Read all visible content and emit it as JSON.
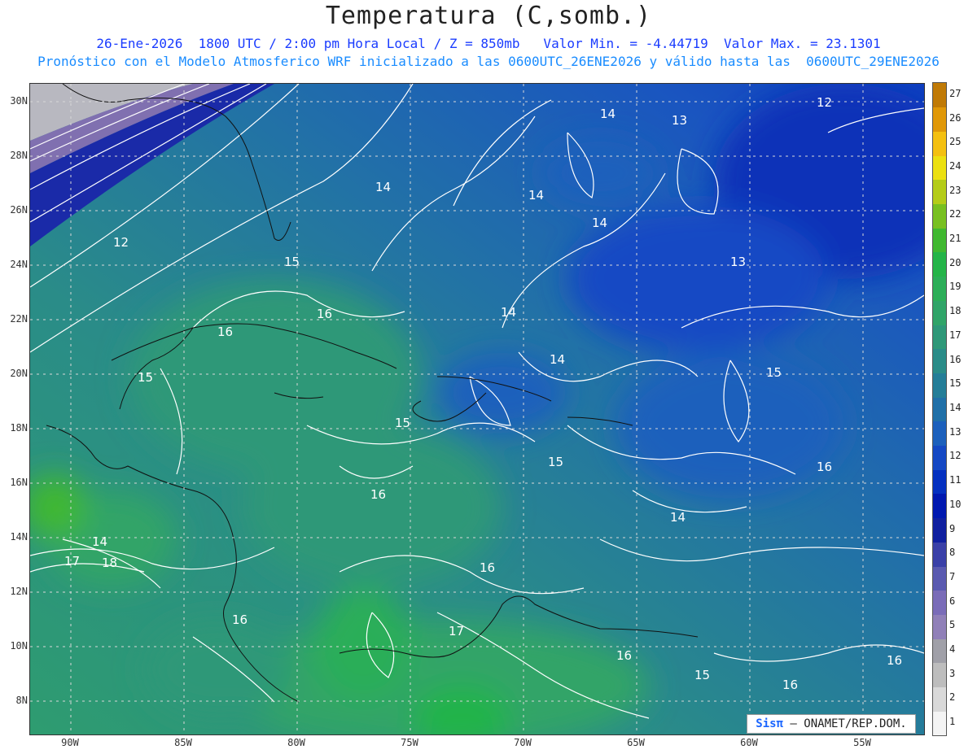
{
  "header": {
    "title": "Temperatura (C,somb.)",
    "line1": "26-Ene-2026  1800 UTC / 2:00 pm Hora Local / Z = 850mb   Valor Min. = -4.44719  Valor Max. = 23.1301",
    "line2": "Pronóstico con el Modelo Atmosferico WRF inicializado a las 0600UTC_26ENE2026 y válido hasta las  0600UTC_29ENE2026"
  },
  "axes": {
    "lat_labels": [
      "30N",
      "28N",
      "26N",
      "24N",
      "22N",
      "20N",
      "18N",
      "16N",
      "14N",
      "12N",
      "10N",
      "8N"
    ],
    "lon_labels": [
      "90W",
      "85W",
      "80W",
      "75W",
      "70W",
      "65W",
      "60W",
      "55W"
    ]
  },
  "colorbar": {
    "levels": [
      "1",
      "2",
      "3",
      "4",
      "5",
      "6",
      "7",
      "8",
      "9",
      "10",
      "11",
      "12",
      "13",
      "14",
      "15",
      "16",
      "17",
      "18",
      "19",
      "20",
      "21",
      "22",
      "23",
      "24",
      "25",
      "26",
      "27"
    ],
    "colors": [
      "#f4f4f4",
      "#d9d9d9",
      "#bdbdbd",
      "#a0a0a8",
      "#9080b8",
      "#7a6cb8",
      "#5a5ab0",
      "#3a40a8",
      "#1020a0",
      "#0018b0",
      "#0430c0",
      "#1448c4",
      "#1c60bc",
      "#2070a8",
      "#247e98",
      "#2a8c88",
      "#2e9878",
      "#30a468",
      "#2cae58",
      "#24b448",
      "#40b830",
      "#78c020",
      "#b4cc18",
      "#ece010",
      "#f4c010",
      "#e09808",
      "#c07a06"
    ]
  },
  "contour_labels": [
    {
      "text": "14"
    },
    {
      "text": "13"
    },
    {
      "text": "12"
    },
    {
      "text": "14"
    },
    {
      "text": "14"
    },
    {
      "text": "14"
    },
    {
      "text": "12"
    },
    {
      "text": "15"
    },
    {
      "text": "13"
    },
    {
      "text": "16"
    },
    {
      "text": "16"
    },
    {
      "text": "14"
    },
    {
      "text": "15"
    },
    {
      "text": "14"
    },
    {
      "text": "15"
    },
    {
      "text": "15"
    },
    {
      "text": "15"
    },
    {
      "text": "16"
    },
    {
      "text": "14"
    },
    {
      "text": "14"
    },
    {
      "text": "18"
    },
    {
      "text": "17"
    },
    {
      "text": "16"
    },
    {
      "text": "16"
    },
    {
      "text": "17"
    },
    {
      "text": "16"
    },
    {
      "text": "15"
    },
    {
      "text": "16"
    },
    {
      "text": "16"
    },
    {
      "text": "16"
    }
  ],
  "credit": {
    "logo": "Sisπ",
    "text": "– ONAMET/REP.DOM."
  }
}
